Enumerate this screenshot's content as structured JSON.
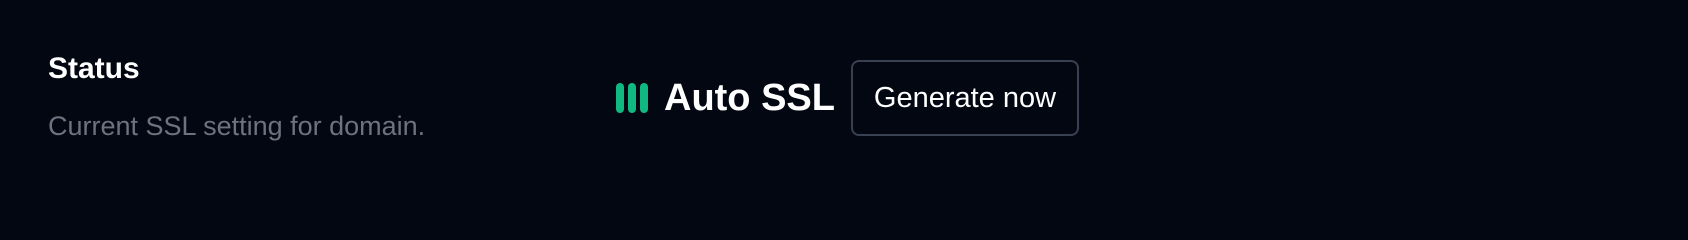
{
  "section": {
    "title": "Status",
    "description": "Current SSL setting for domain."
  },
  "ssl_status": {
    "icon": "status-bars-icon",
    "color": "#10b981",
    "label": "Auto SSL"
  },
  "actions": {
    "generate_label": "Generate now"
  },
  "colors": {
    "background": "#030712",
    "heading": "#ffffff",
    "muted_text": "#6b7280",
    "button_border": "#374151"
  }
}
